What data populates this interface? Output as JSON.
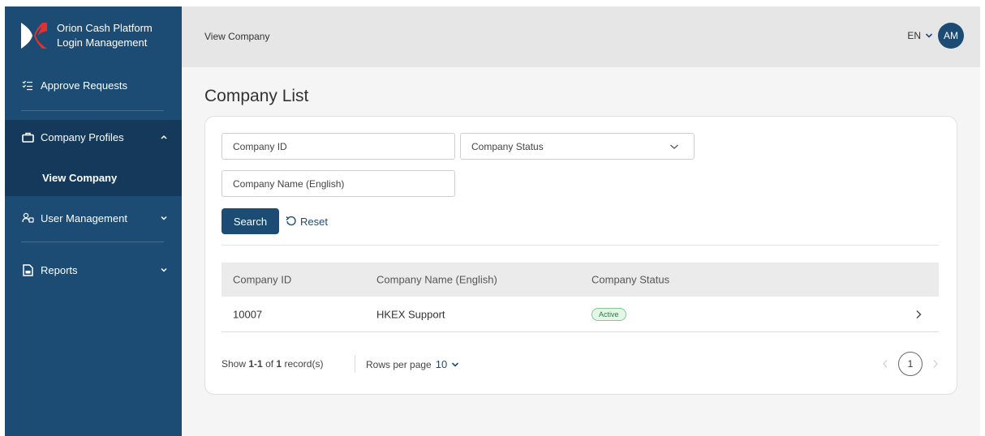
{
  "sidebar": {
    "brand": {
      "line1": "Orion Cash Platform",
      "line2": "Login Management"
    },
    "items": [
      {
        "label": "Approve Requests",
        "icon": "approve-list-icon"
      },
      {
        "label": "Company Profiles",
        "icon": "briefcase-icon",
        "expanded": true,
        "children": [
          {
            "label": "View Company",
            "active": true
          }
        ]
      },
      {
        "label": "User Management",
        "icon": "users-icon",
        "expanded": false
      },
      {
        "label": "Reports",
        "icon": "report-icon",
        "expanded": false
      }
    ],
    "colors": {
      "background": "#1c4c74",
      "active": "#15395b"
    }
  },
  "header": {
    "breadcrumb": "View Company",
    "language": "EN",
    "avatar_initials": "AM"
  },
  "main": {
    "title": "Company List",
    "filters": {
      "company_id_placeholder": "Company ID",
      "company_status_placeholder": "Company Status",
      "company_name_placeholder": "Company Name (English)"
    },
    "search_label": "Search",
    "reset_label": "Reset",
    "table": {
      "columns": [
        "Company ID",
        "Company Name (English)",
        "Company Status"
      ],
      "rows": [
        {
          "company_id": "10007",
          "company_name": "HKEX Support",
          "status": "Active"
        }
      ]
    },
    "footer": {
      "show_prefix": "Show",
      "range": "1-1",
      "of": "of",
      "total": "1",
      "suffix": "record(s)",
      "rows_per_page_label": "Rows per page",
      "rows_per_page_value": "10"
    },
    "pagination": {
      "current_page": "1"
    }
  },
  "colors": {
    "accent": "#1c4c74",
    "status_active": "#2f7a43"
  }
}
